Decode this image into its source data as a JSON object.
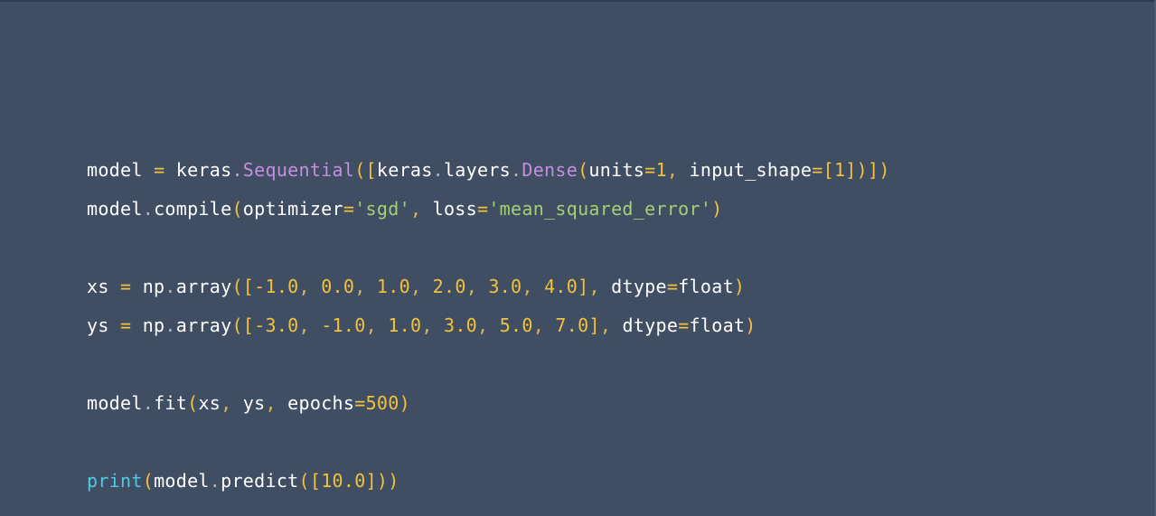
{
  "theme": {
    "background": "#3f4e63",
    "plain": "#ffffff",
    "operator": "#f3c13a",
    "string": "#a3d077",
    "class": "#c58ee0",
    "builtin": "#52c7e6"
  },
  "code": {
    "lines": [
      [
        {
          "t": "model",
          "c": "plain"
        },
        {
          "t": " ",
          "c": "plain"
        },
        {
          "t": "=",
          "c": "op"
        },
        {
          "t": " keras",
          "c": "plain"
        },
        {
          "t": ".",
          "c": "dot"
        },
        {
          "t": "Sequential",
          "c": "cls"
        },
        {
          "t": "([",
          "c": "paren"
        },
        {
          "t": "keras",
          "c": "plain"
        },
        {
          "t": ".",
          "c": "dot"
        },
        {
          "t": "layers",
          "c": "plain"
        },
        {
          "t": ".",
          "c": "dot"
        },
        {
          "t": "Dense",
          "c": "cls"
        },
        {
          "t": "(",
          "c": "paren"
        },
        {
          "t": "units",
          "c": "plain"
        },
        {
          "t": "=",
          "c": "op"
        },
        {
          "t": "1",
          "c": "num"
        },
        {
          "t": ",",
          "c": "punct"
        },
        {
          "t": " input_shape",
          "c": "plain"
        },
        {
          "t": "=[",
          "c": "op"
        },
        {
          "t": "1",
          "c": "num"
        },
        {
          "t": "])])",
          "c": "paren"
        }
      ],
      [
        {
          "t": "model",
          "c": "plain"
        },
        {
          "t": ".",
          "c": "dot"
        },
        {
          "t": "compile",
          "c": "plain"
        },
        {
          "t": "(",
          "c": "paren"
        },
        {
          "t": "optimizer",
          "c": "plain"
        },
        {
          "t": "=",
          "c": "op"
        },
        {
          "t": "'sgd'",
          "c": "str"
        },
        {
          "t": ",",
          "c": "punct"
        },
        {
          "t": " loss",
          "c": "plain"
        },
        {
          "t": "=",
          "c": "op"
        },
        {
          "t": "'mean_squared_error'",
          "c": "str"
        },
        {
          "t": ")",
          "c": "paren"
        }
      ],
      [],
      [
        {
          "t": "xs",
          "c": "plain"
        },
        {
          "t": " ",
          "c": "plain"
        },
        {
          "t": "=",
          "c": "op"
        },
        {
          "t": " np",
          "c": "plain"
        },
        {
          "t": ".",
          "c": "dot"
        },
        {
          "t": "array",
          "c": "plain"
        },
        {
          "t": "([",
          "c": "paren"
        },
        {
          "t": "-1.0",
          "c": "num"
        },
        {
          "t": ",",
          "c": "punct"
        },
        {
          "t": " 0.0",
          "c": "num"
        },
        {
          "t": ",",
          "c": "punct"
        },
        {
          "t": " 1.0",
          "c": "num"
        },
        {
          "t": ",",
          "c": "punct"
        },
        {
          "t": " 2.0",
          "c": "num"
        },
        {
          "t": ",",
          "c": "punct"
        },
        {
          "t": " 3.0",
          "c": "num"
        },
        {
          "t": ",",
          "c": "punct"
        },
        {
          "t": " 4.0",
          "c": "num"
        },
        {
          "t": "]",
          "c": "paren"
        },
        {
          "t": ",",
          "c": "punct"
        },
        {
          "t": " dtype",
          "c": "plain"
        },
        {
          "t": "=",
          "c": "op"
        },
        {
          "t": "float",
          "c": "plain"
        },
        {
          "t": ")",
          "c": "paren"
        }
      ],
      [
        {
          "t": "ys",
          "c": "plain"
        },
        {
          "t": " ",
          "c": "plain"
        },
        {
          "t": "=",
          "c": "op"
        },
        {
          "t": " np",
          "c": "plain"
        },
        {
          "t": ".",
          "c": "dot"
        },
        {
          "t": "array",
          "c": "plain"
        },
        {
          "t": "([",
          "c": "paren"
        },
        {
          "t": "-3.0",
          "c": "num"
        },
        {
          "t": ",",
          "c": "punct"
        },
        {
          "t": " -1.0",
          "c": "num"
        },
        {
          "t": ",",
          "c": "punct"
        },
        {
          "t": " 1.0",
          "c": "num"
        },
        {
          "t": ",",
          "c": "punct"
        },
        {
          "t": " 3.0",
          "c": "num"
        },
        {
          "t": ",",
          "c": "punct"
        },
        {
          "t": " 5.0",
          "c": "num"
        },
        {
          "t": ",",
          "c": "punct"
        },
        {
          "t": " 7.0",
          "c": "num"
        },
        {
          "t": "]",
          "c": "paren"
        },
        {
          "t": ",",
          "c": "punct"
        },
        {
          "t": " dtype",
          "c": "plain"
        },
        {
          "t": "=",
          "c": "op"
        },
        {
          "t": "float",
          "c": "plain"
        },
        {
          "t": ")",
          "c": "paren"
        }
      ],
      [],
      [
        {
          "t": "model",
          "c": "plain"
        },
        {
          "t": ".",
          "c": "dot"
        },
        {
          "t": "fit",
          "c": "plain"
        },
        {
          "t": "(",
          "c": "paren"
        },
        {
          "t": "xs",
          "c": "plain"
        },
        {
          "t": ",",
          "c": "punct"
        },
        {
          "t": " ys",
          "c": "plain"
        },
        {
          "t": ",",
          "c": "punct"
        },
        {
          "t": " epochs",
          "c": "plain"
        },
        {
          "t": "=",
          "c": "op"
        },
        {
          "t": "500",
          "c": "num"
        },
        {
          "t": ")",
          "c": "paren"
        }
      ],
      [],
      [
        {
          "t": "print",
          "c": "builtin"
        },
        {
          "t": "(",
          "c": "paren"
        },
        {
          "t": "model",
          "c": "plain"
        },
        {
          "t": ".",
          "c": "dot"
        },
        {
          "t": "predict",
          "c": "plain"
        },
        {
          "t": "([",
          "c": "paren"
        },
        {
          "t": "10.0",
          "c": "num"
        },
        {
          "t": "]))",
          "c": "paren"
        }
      ]
    ]
  }
}
